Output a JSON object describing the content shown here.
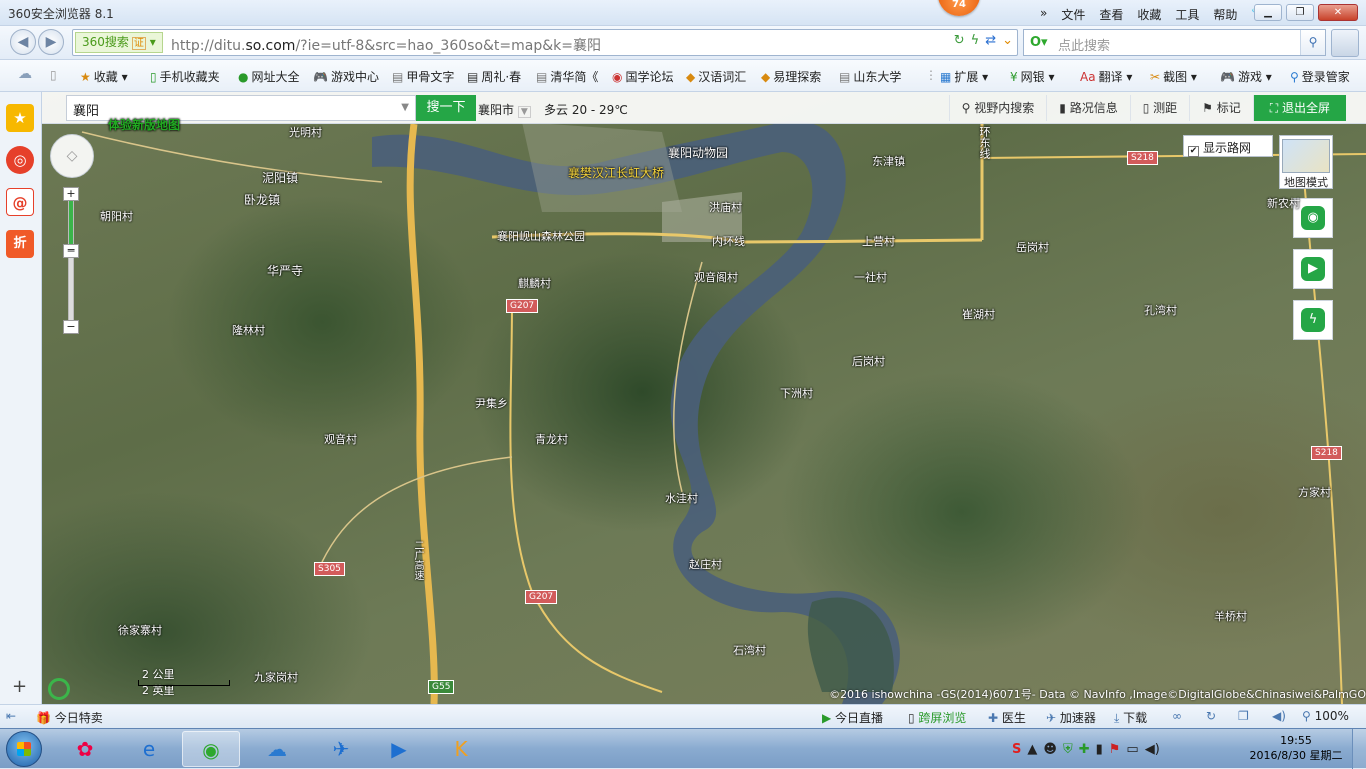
{
  "browser": {
    "title": "360安全浏览器 8.1",
    "badge": "74",
    "menus": [
      "文件",
      "查看",
      "收藏",
      "工具",
      "帮助"
    ],
    "secure_label": "360搜索",
    "secure_badge": "证",
    "url_host_prefix": "http://ditu.",
    "url_host": "so.com",
    "url_rest": "/?ie=utf-8&src=hao_360so&t=map&k=襄阳",
    "search_placeholder": "点此搜索"
  },
  "favorites": [
    {
      "label": "收藏",
      "icon": "star-icon"
    },
    {
      "label": "手机收藏夹",
      "icon": "phone-icon"
    },
    {
      "label": "网址大全",
      "icon": "site-icon"
    },
    {
      "label": "游戏中心",
      "icon": "gamepad-icon"
    },
    {
      "label": "甲骨文字",
      "icon": "page-icon"
    },
    {
      "label": "周礼·春",
      "icon": "page-icon"
    },
    {
      "label": "清华简《",
      "icon": "page-icon"
    },
    {
      "label": "国学论坛",
      "icon": "page-icon"
    },
    {
      "label": "汉语词汇",
      "icon": "page-icon"
    },
    {
      "label": "易理探索",
      "icon": "page-icon"
    },
    {
      "label": "山东大学",
      "icon": "page-icon"
    },
    {
      "label": "扩展",
      "icon": "grid-icon"
    },
    {
      "label": "网银",
      "icon": "bank-icon"
    },
    {
      "label": "翻译",
      "icon": "translate-icon"
    },
    {
      "label": "截图",
      "icon": "scissors-icon"
    },
    {
      "label": "游戏",
      "icon": "gamepad-icon"
    },
    {
      "label": "登录管家",
      "icon": "key-icon"
    }
  ],
  "map": {
    "search_value": "襄阳",
    "search_button": "搜一下",
    "city": "襄阳市",
    "weather": "多云 20 - 29℃",
    "tools": [
      "视野内搜索",
      "路况信息",
      "测距",
      "标记",
      "退出全屏"
    ],
    "road_network_label": "显示路网",
    "map_mode_label": "地图模式",
    "scale_km": "2 公里",
    "scale_mi": "2 英里",
    "credit": "©2016 ishowchina -GS(2014)6071号- Data © NavInfo ,Image©DigitalGlobe&Chinasiwei&PalmGO",
    "banner_text": "体验新版地图",
    "labels": {
      "xiangyang_museum": "襄阳动物园",
      "bridge": "襄樊汉江长虹大桥",
      "forest_park": "襄阳岘山森林公园",
      "guangming": "光明村",
      "niyang": "泥阳镇",
      "wolong": "卧龙镇",
      "chaoyang": "朝阳村",
      "huayan": "华严寺",
      "longlin": "隆林村",
      "qilin": "麒麟村",
      "hongmiao": "洪庙村",
      "guanyinge": "观音阁村",
      "inner_ring": "内环线",
      "east_ring": "环东线",
      "dongjin": "东津镇",
      "shangying": "上营村",
      "yueguang": "岳岗村",
      "xinnong": "新农村",
      "yishe": "一社村",
      "yaohu": "崔湖村",
      "kongwan": "孔湾村",
      "yinji": "尹集乡",
      "guanyin": "观音村",
      "qinglong": "青龙村",
      "shuiwa": "水洼村",
      "zhaozhuang": "赵庄村",
      "shiwan": "石湾村",
      "xiazhou": "下洲村",
      "hougang": "后岗村",
      "fangmao": "方家村",
      "yangqiao": "羊桥村",
      "xujiazhai": "徐家寨村",
      "jiujiagang": "九家岗村",
      "highway": "二广高速"
    },
    "route_shields": {
      "g207_a": "G207",
      "g207_b": "G207",
      "s305": "S305",
      "s218_a": "S218",
      "s218_b": "S218",
      "g55": "G55"
    }
  },
  "statusbar": {
    "left": "今日特卖",
    "items": [
      "今日直播",
      "跨屏浏览",
      "医生",
      "加速器",
      "下载"
    ],
    "zoom": "100%"
  },
  "taskbar": {
    "time": "19:55",
    "date": "2016/8/30 星期二"
  },
  "colors": {
    "accent_green": "#25a646",
    "route_red": "#d25b5b"
  }
}
